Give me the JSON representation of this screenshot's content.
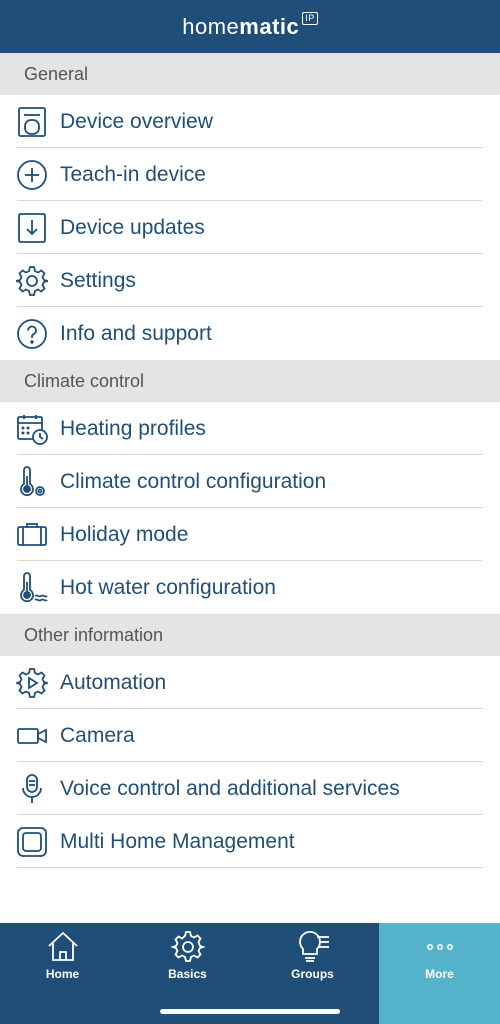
{
  "header": {
    "brand_light": "home",
    "brand_bold": "matic",
    "brand_badge": "IP"
  },
  "sections": [
    {
      "title": "General",
      "items": [
        {
          "label": "Device overview",
          "icon": "device-overview-icon"
        },
        {
          "label": "Teach-in device",
          "icon": "plus-circle-icon"
        },
        {
          "label": "Device updates",
          "icon": "download-icon"
        },
        {
          "label": "Settings",
          "icon": "gear-icon"
        },
        {
          "label": "Info and support",
          "icon": "question-circle-icon"
        }
      ]
    },
    {
      "title": "Climate control",
      "items": [
        {
          "label": "Heating profiles",
          "icon": "calendar-clock-icon"
        },
        {
          "label": "Climate control configuration",
          "icon": "thermometer-gear-icon"
        },
        {
          "label": "Holiday mode",
          "icon": "suitcase-icon"
        },
        {
          "label": "Hot water configuration",
          "icon": "thermometer-water-icon"
        }
      ]
    },
    {
      "title": "Other information",
      "items": [
        {
          "label": "Automation",
          "icon": "automation-gear-play-icon"
        },
        {
          "label": "Camera",
          "icon": "camera-icon"
        },
        {
          "label": "Voice control and additional services",
          "icon": "microphone-icon"
        },
        {
          "label": "Multi Home Management",
          "icon": "multi-home-icon"
        }
      ]
    }
  ],
  "tabbar": {
    "tabs": [
      {
        "label": "Home",
        "icon": "house-icon"
      },
      {
        "label": "Basics",
        "icon": "gear-icon"
      },
      {
        "label": "Groups",
        "icon": "lightbulb-list-icon"
      },
      {
        "label": "More",
        "icon": "more-dots-icon",
        "active": true
      }
    ]
  },
  "colors": {
    "primary": "#1f4f78",
    "active_tab": "#56b3cc",
    "section_bg": "#e4e4e4"
  }
}
